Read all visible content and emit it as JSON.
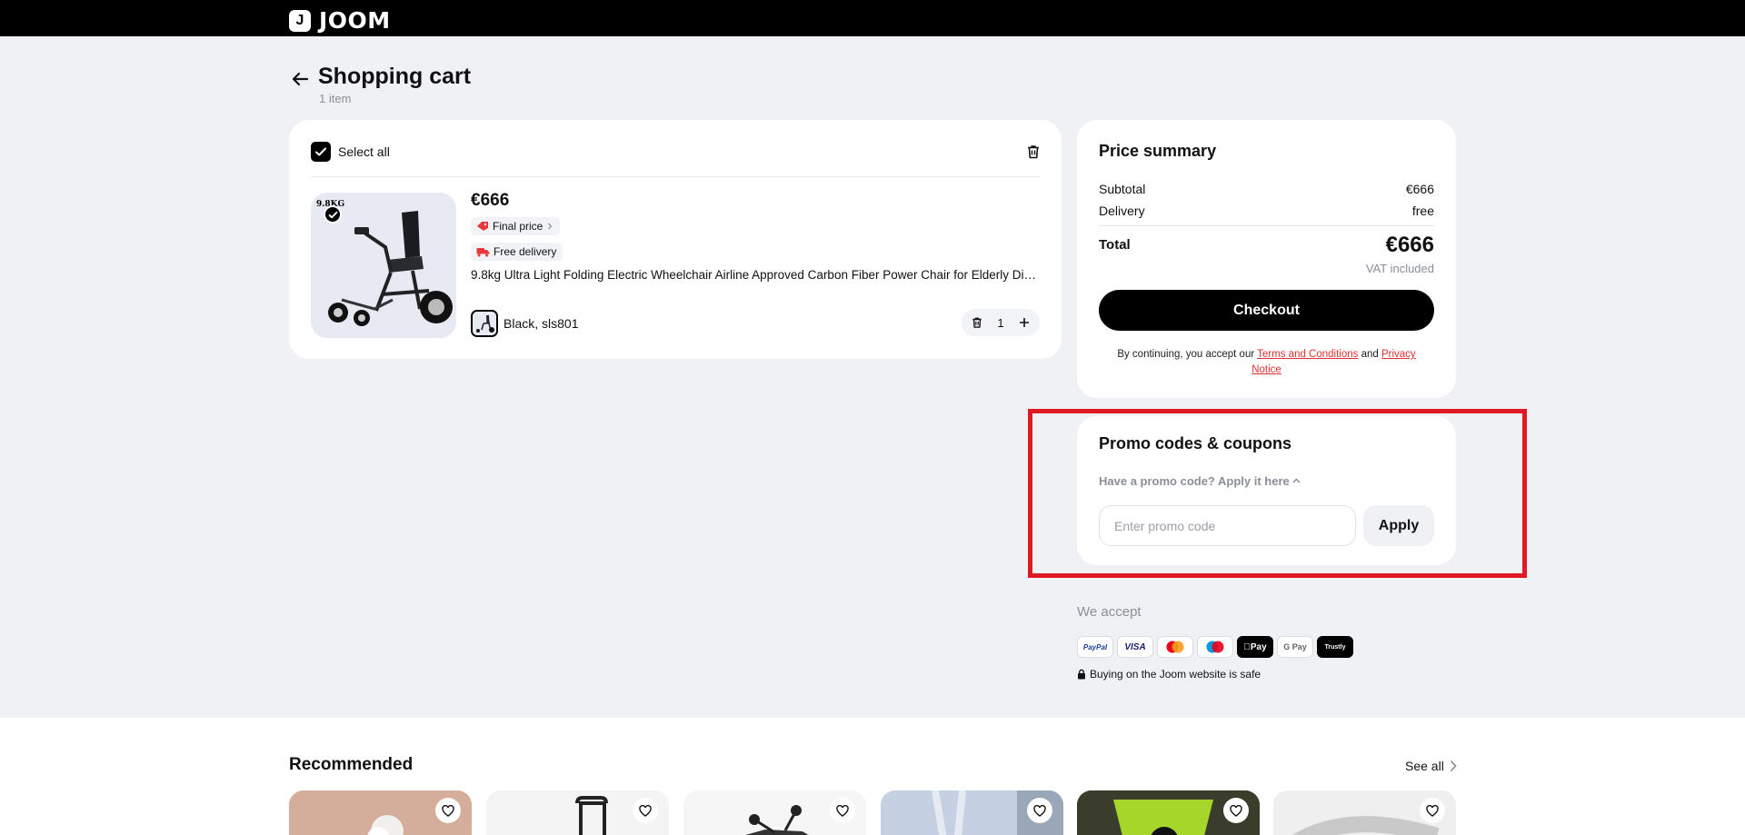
{
  "header": {
    "logo_text": "JOOM",
    "logo_mark": "J"
  },
  "cart": {
    "title": "Shopping cart",
    "item_count": "1 item",
    "select_all_label": "Select all",
    "item": {
      "image_label": "9.8KG",
      "price": "€666",
      "final_price_label": "Final price",
      "free_delivery_label": "Free delivery",
      "name": "9.8kg Ultra Light Folding Electric Wheelchair Airline Approved Carbon Fiber Power Chair for Elderly Disabled",
      "variant": "Black, sls801",
      "quantity": "1"
    }
  },
  "summary": {
    "title": "Price summary",
    "subtotal_label": "Subtotal",
    "subtotal_value": "€666",
    "delivery_label": "Delivery",
    "delivery_value": "free",
    "total_label": "Total",
    "total_value": "€666",
    "vat_note": "VAT included",
    "checkout_label": "Checkout",
    "legal_prefix": "By continuing, you accept our ",
    "terms_link": "Terms and Conditions",
    "legal_and": " and ",
    "privacy_link": "Privacy Notice"
  },
  "promo": {
    "title": "Promo codes & coupons",
    "toggle_label": "Have a promo code? Apply it here",
    "input_placeholder": "Enter promo code",
    "apply_label": "Apply"
  },
  "payment": {
    "we_accept": "We accept",
    "methods": [
      "PayPal",
      "VISA",
      "Mastercard",
      "Maestro",
      "Apple Pay",
      "G Pay",
      "Trustly"
    ],
    "safe_text": "Buying on the Joom website is safe"
  },
  "recommended": {
    "title": "Recommended",
    "see_all": "See all"
  },
  "colors": {
    "accent_red": "#e0312e",
    "highlight": "#e01a24",
    "background": "#f0f1f5"
  }
}
